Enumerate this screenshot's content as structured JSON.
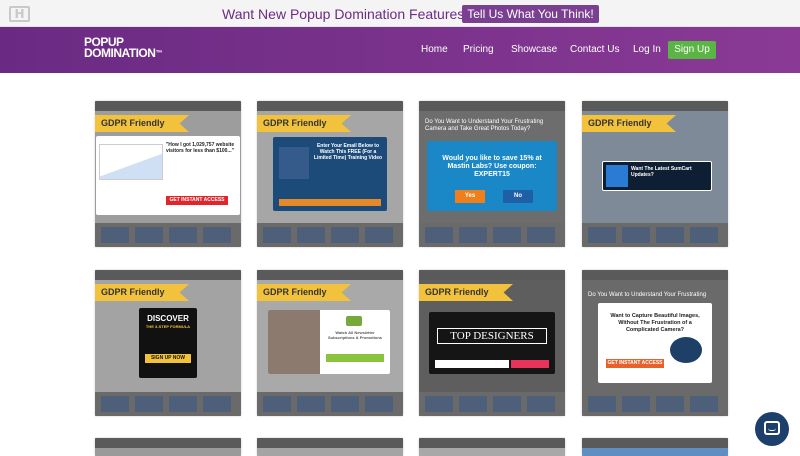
{
  "topbar": {
    "logo_glyph": "H",
    "announcement": "Want New Popup Domination Features?",
    "cta_label": "Tell Us What You Think!"
  },
  "header": {
    "brand_line1": "POPUP",
    "brand_line2": "DOMINATION",
    "brand_mark": "™",
    "nav": [
      "Home",
      "Pricing",
      "Showcase",
      "Contact Us",
      "Log In"
    ],
    "signup_label": "Sign Up"
  },
  "showcase": {
    "badge": "GDPR Friendly",
    "items": [
      {
        "headline": "\"How I got 1,029,757 website visitors for less than $100...\"",
        "button": "GET INSTANT ACCESS"
      },
      {
        "headline": "Enter Your Email Below to Watch This FREE (For a Limited Time) Training Video"
      },
      {
        "headline": "Do You Want to Understand Your Frustrating Camera and Take Great Photos Today?",
        "offer": "Would you like to save 15% at Mastin Labs? Use coupon: EXPERT15",
        "yes": "Yes",
        "no": "No"
      },
      {
        "headline": "Want The Latest SumCart Updates?"
      },
      {
        "headline": "DISCOVER",
        "sub": "THE 3-STEP FORMULA",
        "button": "SIGN UP NOW"
      },
      {
        "headline": "Watch All Newsletter Subscriptions & Promotions"
      },
      {
        "headline": "TOP DESIGNERS"
      },
      {
        "headline": "Do You Want to Understand Your Frustrating",
        "sub": "Want to Capture Beautiful Images, Without The Frustration of a Complicated Camera?",
        "button": "GET INSTANT ACCESS"
      }
    ]
  },
  "colors": {
    "purple": "#6a2a83",
    "green": "#5bb544",
    "badge_yellow": "#f2c23c",
    "chat_navy": "#1d3f6b"
  },
  "icons": {
    "chat": "chat-bubble-icon"
  }
}
